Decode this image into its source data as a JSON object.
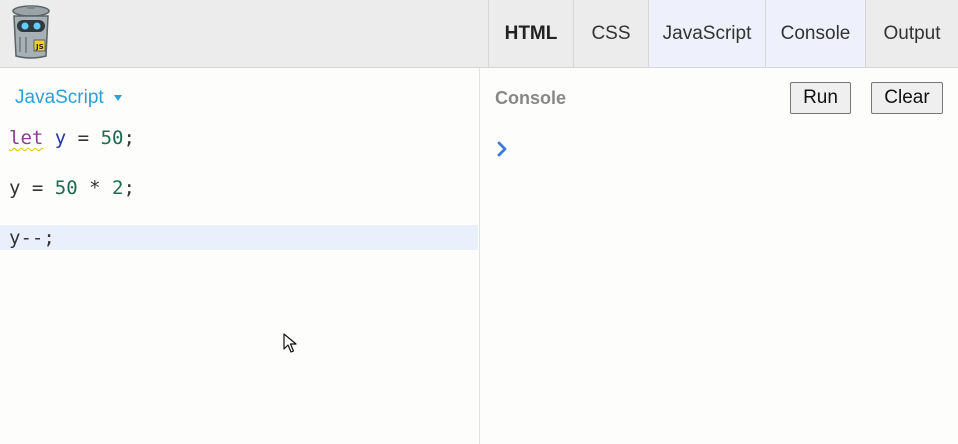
{
  "header": {
    "logo_icon": "trash-can-robot-logo-icon",
    "tabs": [
      {
        "label": "HTML",
        "active": true
      },
      {
        "label": "CSS",
        "active": false
      },
      {
        "label": "JavaScript",
        "active": false,
        "selected": true
      },
      {
        "label": "Console",
        "active": false,
        "selected": true
      },
      {
        "label": "Output",
        "active": false
      }
    ]
  },
  "editor": {
    "language": "JavaScript",
    "language_caret_icon": "caret-down-icon",
    "code": {
      "line1": {
        "kw": "let",
        "var": "y",
        "op": " = ",
        "num": "50",
        "end": ";"
      },
      "line2": {
        "var": "y",
        "op": " = ",
        "num1": "50",
        "op2": " * ",
        "num2": "2",
        "end": ";"
      },
      "line3": {
        "text": "y--;"
      }
    }
  },
  "console": {
    "title": "Console",
    "run_label": "Run",
    "clear_label": "Clear",
    "prompt_icon": "chevron-right-icon"
  },
  "colors": {
    "accent_blue": "#2ba0d8",
    "keyword": "#8a3e91",
    "variable": "#1f36a8",
    "number": "#1b6b53",
    "active_line": "#e9f0fb",
    "prompt": "#3b7be0"
  }
}
